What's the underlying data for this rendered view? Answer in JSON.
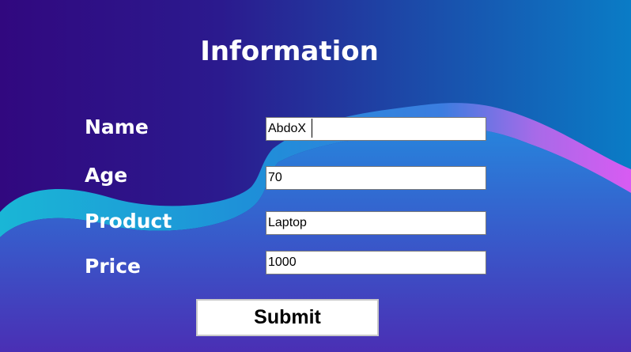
{
  "form": {
    "title": "Information",
    "fields": [
      {
        "label": "Name",
        "value": "AbdoX"
      },
      {
        "label": "Age",
        "value": "70"
      },
      {
        "label": "Product",
        "value": "Laptop"
      },
      {
        "label": "Price",
        "value": "1000"
      }
    ],
    "submit_label": "Submit"
  },
  "colors": {
    "background_left": "#31087f",
    "background_right": "#0a7cc6",
    "wave_cyan": "#14a9d4",
    "wave_magenta": "#d35af0",
    "lower_panel_top": "#2784dc",
    "lower_panel_bottom": "#4a2fb4"
  }
}
